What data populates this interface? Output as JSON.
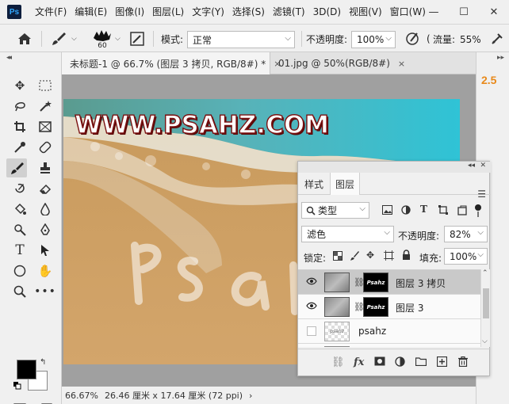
{
  "app": {
    "logo": "Ps",
    "menu": [
      "文件(F)",
      "编辑(E)",
      "图像(I)",
      "图层(L)",
      "文字(Y)",
      "选择(S)",
      "滤镜(T)",
      "3D(D)",
      "视图(V)",
      "窗口(W)"
    ],
    "window_controls": {
      "minimize": "—",
      "restore": "☐",
      "close": "✕"
    }
  },
  "options_bar": {
    "brush_size": "60",
    "mode_label": "模式:",
    "mode_value": "正常",
    "opacity_label": "不透明度:",
    "opacity_value": "100%",
    "flow_label": "流量:",
    "flow_value": "55%"
  },
  "tabs": [
    {
      "label": "未标题-1 @ 66.7% (图层 3 拷贝, RGB/8#) *",
      "close": "×"
    },
    {
      "label": "01.jpg @ 50%(RGB/8#)",
      "close": "×"
    }
  ],
  "canvas": {
    "watermark_text": "WWW.PSAHZ.COM"
  },
  "status_bar": {
    "zoom": "66.67%",
    "doc_size": "26.46 厘米 x 17.64 厘米 (72 ppi)",
    "arrow": "›"
  },
  "dock": {
    "value": "2.5"
  },
  "layers_panel": {
    "tabs": [
      "样式",
      "图层"
    ],
    "filter_kind": "类型",
    "blend_mode": "滤色",
    "opacity_label": "不透明度:",
    "opacity_value": "82%",
    "lock_label": "锁定:",
    "fill_label": "填充:",
    "fill_value": "100%",
    "layers": [
      {
        "name": "图层 3 拷贝",
        "visible": true,
        "selected": true,
        "mask_text": "Psahz"
      },
      {
        "name": "图层 3",
        "visible": true,
        "selected": false,
        "mask_text": "Psahz"
      },
      {
        "name": "psahz",
        "visible": false,
        "selected": false,
        "mask_text": "psahz"
      }
    ]
  },
  "colors": {
    "foreground": "#000000",
    "background": "#ffffff",
    "accent_orange": "#e8891a",
    "watermark_outline": "#7a1010"
  }
}
